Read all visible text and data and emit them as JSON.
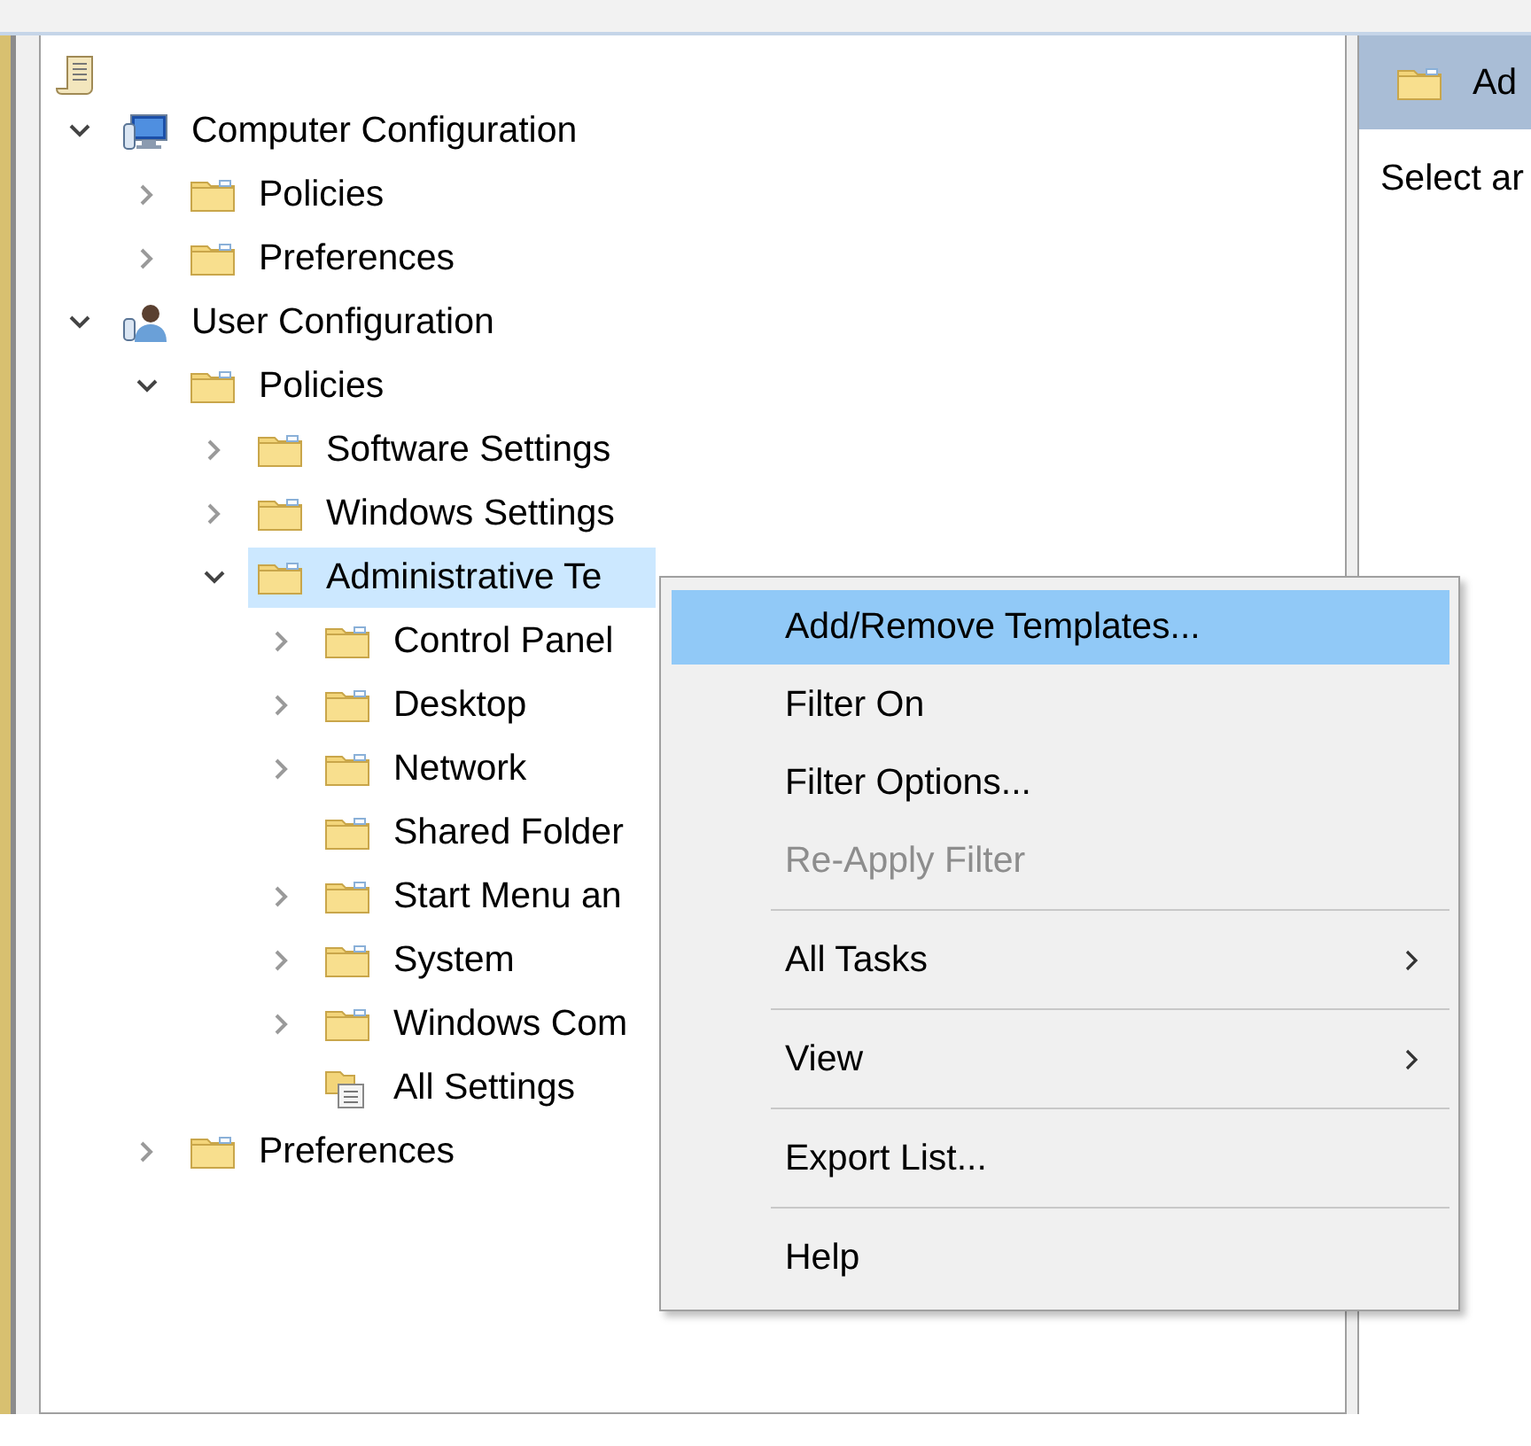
{
  "tree": {
    "items": [
      {
        "label": "Computer Configuration",
        "kind": "computer",
        "expanded": true,
        "selected": false,
        "children": [
          {
            "label": "Policies",
            "kind": "folder",
            "expanded": false,
            "selected": false
          },
          {
            "label": "Preferences",
            "kind": "folder",
            "expanded": false,
            "selected": false
          }
        ]
      },
      {
        "label": "User Configuration",
        "kind": "user",
        "expanded": true,
        "selected": false,
        "children": [
          {
            "label": "Policies",
            "kind": "folder",
            "expanded": true,
            "selected": false,
            "children": [
              {
                "label": "Software Settings",
                "kind": "folder",
                "expanded": false,
                "selected": false
              },
              {
                "label": "Windows Settings",
                "kind": "folder",
                "expanded": false,
                "selected": false
              },
              {
                "label": "Administrative Te",
                "kind": "folder",
                "expanded": true,
                "selected": true,
                "children": [
                  {
                    "label": "Control Panel",
                    "kind": "folder",
                    "expanded": false,
                    "selected": false
                  },
                  {
                    "label": "Desktop",
                    "kind": "folder",
                    "expanded": false,
                    "selected": false
                  },
                  {
                    "label": "Network",
                    "kind": "folder",
                    "expanded": false,
                    "selected": false
                  },
                  {
                    "label": "Shared Folder",
                    "kind": "folder",
                    "selected": false
                  },
                  {
                    "label": "Start Menu an",
                    "kind": "folder",
                    "expanded": false,
                    "selected": false
                  },
                  {
                    "label": "System",
                    "kind": "folder",
                    "expanded": false,
                    "selected": false
                  },
                  {
                    "label": "Windows Com",
                    "kind": "folder",
                    "expanded": false,
                    "selected": false
                  },
                  {
                    "label": "All Settings",
                    "kind": "settings",
                    "selected": false
                  }
                ]
              }
            ]
          },
          {
            "label": "Preferences",
            "kind": "folder",
            "expanded": false,
            "selected": false
          }
        ]
      }
    ]
  },
  "details": {
    "title": "Ad",
    "description": "Select ar"
  },
  "context_menu": {
    "items": [
      {
        "kind": "item",
        "label": "Add/Remove Templates...",
        "selected": true,
        "disabled": false,
        "submenu": false
      },
      {
        "kind": "item",
        "label": "Filter On",
        "selected": false,
        "disabled": false,
        "submenu": false
      },
      {
        "kind": "item",
        "label": "Filter Options...",
        "selected": false,
        "disabled": false,
        "submenu": false
      },
      {
        "kind": "item",
        "label": "Re-Apply Filter",
        "selected": false,
        "disabled": true,
        "submenu": false
      },
      {
        "kind": "separator"
      },
      {
        "kind": "item",
        "label": "All Tasks",
        "selected": false,
        "disabled": false,
        "submenu": true
      },
      {
        "kind": "separator"
      },
      {
        "kind": "item",
        "label": "View",
        "selected": false,
        "disabled": false,
        "submenu": true
      },
      {
        "kind": "separator"
      },
      {
        "kind": "item",
        "label": "Export List...",
        "selected": false,
        "disabled": false,
        "submenu": false
      },
      {
        "kind": "separator"
      },
      {
        "kind": "item",
        "label": "Help",
        "selected": false,
        "disabled": false,
        "submenu": false
      }
    ]
  }
}
